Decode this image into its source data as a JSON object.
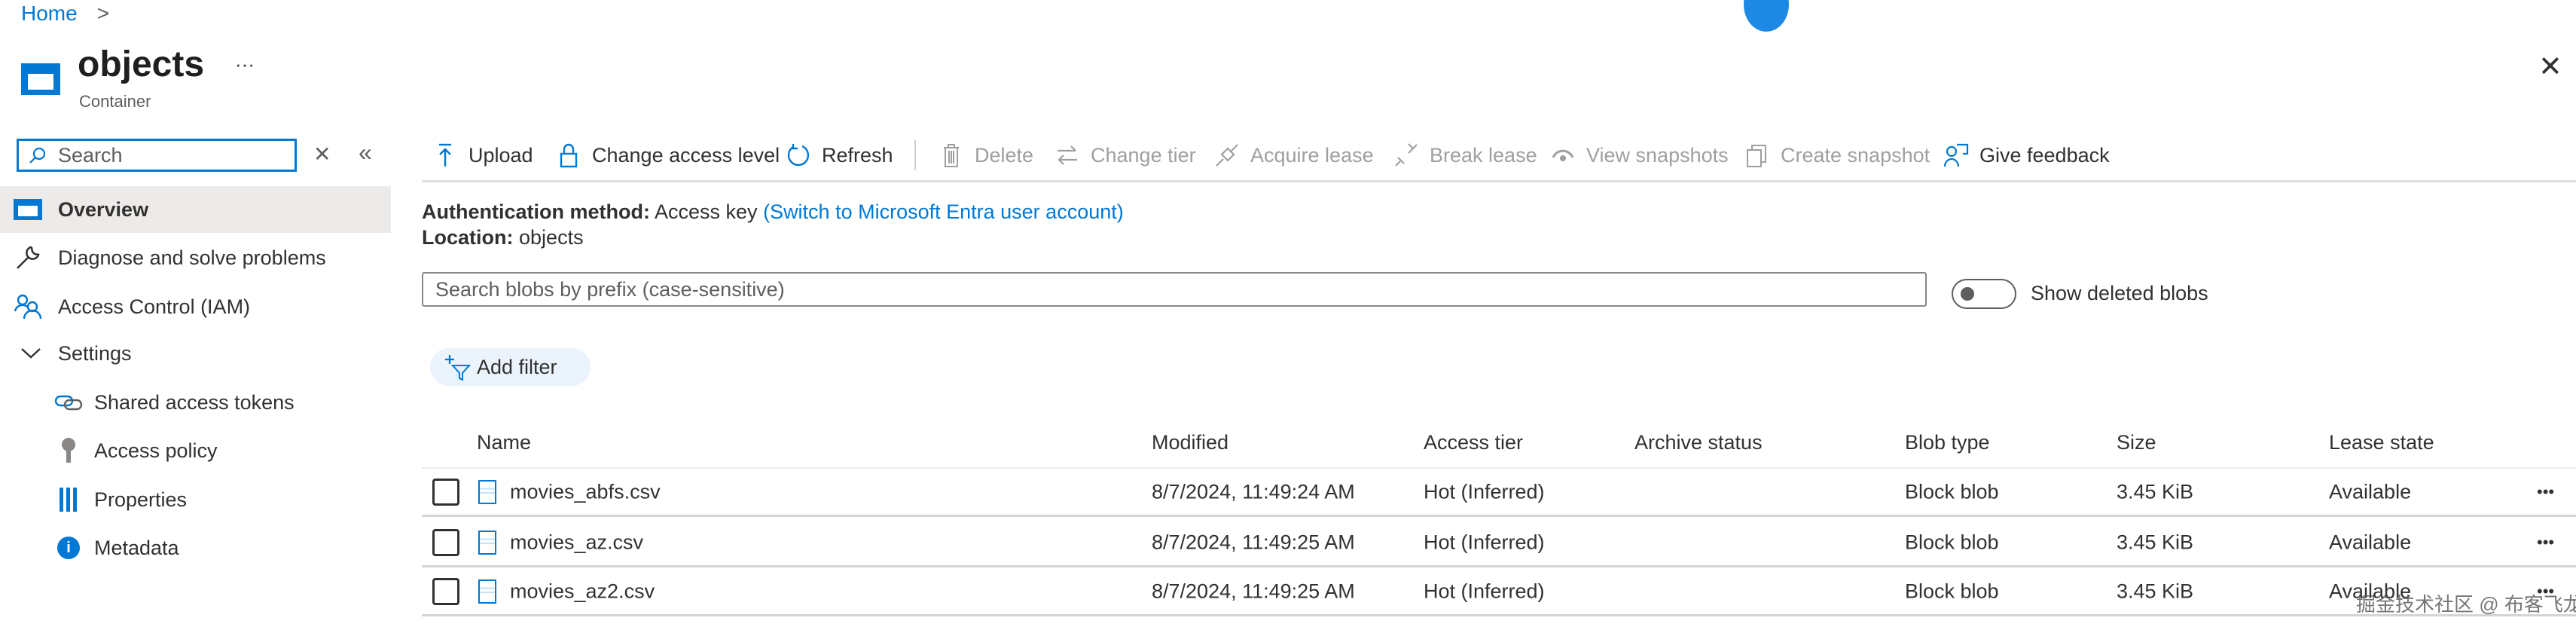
{
  "breadcrumb": {
    "home": "Home",
    "separator": ">"
  },
  "header": {
    "title": "objects",
    "subtitle": "Container",
    "more": "···",
    "close": "✕"
  },
  "sidebar": {
    "search_placeholder": "Search",
    "items": [
      {
        "label": "Overview",
        "icon": "container-icon",
        "selected": true
      },
      {
        "label": "Diagnose and solve problems",
        "icon": "wrench-icon"
      },
      {
        "label": "Access Control (IAM)",
        "icon": "people-icon"
      },
      {
        "label": "Settings",
        "icon": "chevron-down-icon"
      },
      {
        "label": "Shared access tokens",
        "icon": "link-icon"
      },
      {
        "label": "Access policy",
        "icon": "key-icon"
      },
      {
        "label": "Properties",
        "icon": "properties-icon"
      },
      {
        "label": "Metadata",
        "icon": "info-icon"
      }
    ]
  },
  "toolbar": {
    "upload": "Upload",
    "change_access": "Change access level",
    "refresh": "Refresh",
    "delete": "Delete",
    "change_tier": "Change tier",
    "acquire_lease": "Acquire lease",
    "break_lease": "Break lease",
    "view_snapshots": "View snapshots",
    "create_snapshot": "Create snapshot",
    "give_feedback": "Give feedback"
  },
  "info": {
    "auth_label": "Authentication method:",
    "auth_value": "Access key",
    "auth_link": "(Switch to Microsoft Entra user account)",
    "location_label": "Location:",
    "location_value": "objects"
  },
  "filter": {
    "search_placeholder": "Search blobs by prefix (case-sensitive)",
    "show_deleted": "Show deleted blobs",
    "show_deleted_on": false,
    "add_filter": "Add filter"
  },
  "table": {
    "columns": [
      "Name",
      "Modified",
      "Access tier",
      "Archive status",
      "Blob type",
      "Size",
      "Lease state"
    ],
    "rows": [
      {
        "name": "movies_abfs.csv",
        "modified": "8/7/2024, 11:49:24 AM",
        "tier": "Hot (Inferred)",
        "archive": "",
        "type": "Block blob",
        "size": "3.45 KiB",
        "lease": "Available"
      },
      {
        "name": "movies_az.csv",
        "modified": "8/7/2024, 11:49:25 AM",
        "tier": "Hot (Inferred)",
        "archive": "",
        "type": "Block blob",
        "size": "3.45 KiB",
        "lease": "Available"
      },
      {
        "name": "movies_az2.csv",
        "modified": "8/7/2024, 11:49:25 AM",
        "tier": "Hot (Inferred)",
        "archive": "",
        "type": "Block blob",
        "size": "3.45 KiB",
        "lease": "Available"
      }
    ],
    "row_menu": "•••"
  },
  "watermark": "掘金技术社区 @ 布客飞龙",
  "colors": {
    "accent": "#0078d4",
    "selected_bg": "#edebe9",
    "disabled": "#a19f9d"
  }
}
